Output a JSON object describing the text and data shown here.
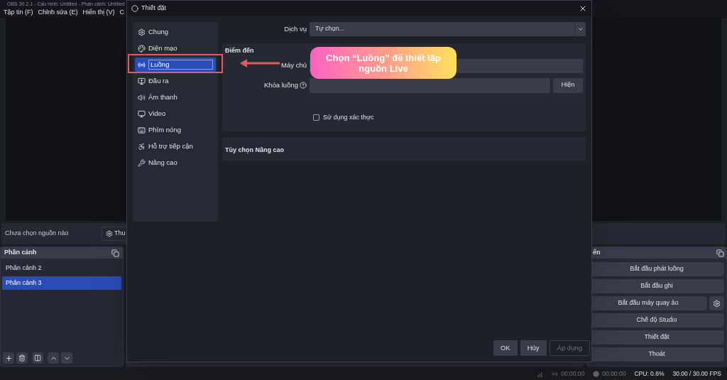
{
  "window": {
    "title": "OBS 30.2.1 - Cấu hình: Untitled - Phân cảnh: Untitled"
  },
  "menu": [
    {
      "label": "Tập tin (F)"
    },
    {
      "label": "Chỉnh sửa (E)"
    },
    {
      "label": "Hiển thị (V)"
    },
    {
      "label": "C"
    }
  ],
  "source_bar": {
    "label": "Chưa chọn nguồn nào",
    "properties_button": "Thu"
  },
  "scenes": {
    "title": "Phân cảnh",
    "items": [
      {
        "label": "Phân cảnh 2",
        "selected": false
      },
      {
        "label": "Phân cảnh 3",
        "selected": true
      }
    ]
  },
  "controls": {
    "title": "ển",
    "buttons": [
      {
        "label": "Bắt đầu phát luồng",
        "settings": false
      },
      {
        "label": "Bắt đầu ghi",
        "settings": false
      },
      {
        "label": "Bắt đầu máy quay ảo",
        "settings": true
      },
      {
        "label": "Chế độ Studio",
        "settings": false
      },
      {
        "label": "Thiết đặt",
        "settings": false
      },
      {
        "label": "Thoát",
        "settings": false
      }
    ]
  },
  "status_bar": {
    "stream_time": "00:00:00",
    "record_time": "00:00:00",
    "cpu": "CPU: 0.6%",
    "fps": "30.00 / 30.00 FPS"
  },
  "dialog": {
    "title": "Thiết đặt",
    "nav": [
      {
        "label": "Chung",
        "kind": "general",
        "selected": false
      },
      {
        "label": "Diện mạo",
        "kind": "appearance",
        "selected": false
      },
      {
        "label": "Luồng",
        "kind": "stream",
        "selected": true
      },
      {
        "label": "Đầu ra",
        "kind": "output",
        "selected": false
      },
      {
        "label": "Âm thanh",
        "kind": "audio",
        "selected": false
      },
      {
        "label": "Video",
        "kind": "video",
        "selected": false
      },
      {
        "label": "Phím nóng",
        "kind": "hotkeys",
        "selected": false
      },
      {
        "label": "Hỗ trợ tiếp cận",
        "kind": "accessibility",
        "selected": false
      },
      {
        "label": "Nâng cao",
        "kind": "advanced",
        "selected": false
      }
    ],
    "service": {
      "label": "Dịch vụ",
      "value": "Tự chọn..."
    },
    "destination": {
      "title": "Điểm đến",
      "server_label": "Máy chủ",
      "key_label": "Khóa luồng",
      "show_button": "Hiện",
      "auth": {
        "label": "Sử dụng xác thực",
        "checked": false
      }
    },
    "advanced": {
      "title": "Tùy chọn Nâng cao"
    },
    "buttons": [
      {
        "label": "OK",
        "disabled": false
      },
      {
        "label": "Hủy",
        "disabled": false
      },
      {
        "label": "Áp dụng",
        "disabled": true
      }
    ]
  },
  "annotation": {
    "text": "Chọn “Luồng” để thiết lập nguồn Live"
  }
}
